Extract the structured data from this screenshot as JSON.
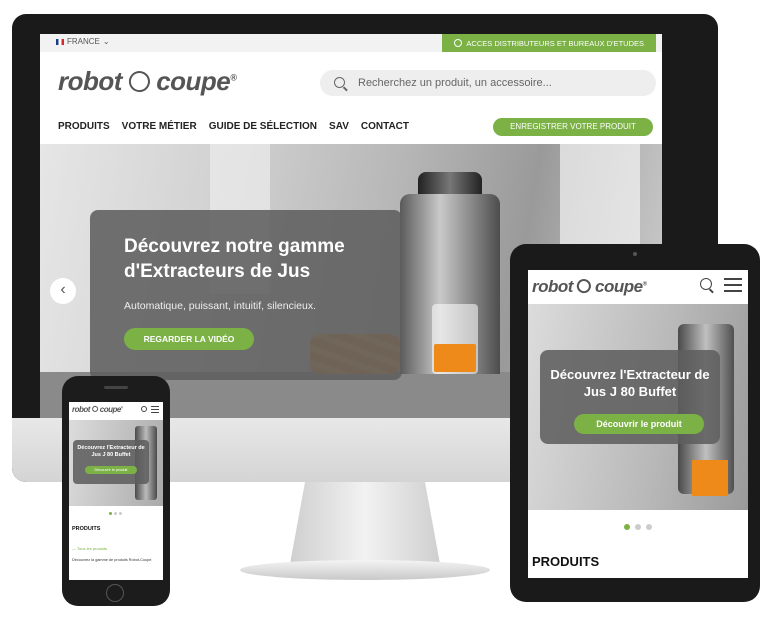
{
  "desktop": {
    "lang_label": "FRANCE",
    "distrib_label": "ACCES DISTRIBUTEURS ET BUREAUX D'ETUDES",
    "logo_left": "robot",
    "logo_right": "coupe",
    "logo_mark": "®",
    "search_placeholder": "Recherchez un produit, un accessoire...",
    "nav": [
      "PRODUITS",
      "VOTRE MÉTIER",
      "GUIDE DE SÉLECTION",
      "SAV",
      "CONTACT"
    ],
    "register_label": "ENREGISTRER VOTRE PRODUIT",
    "hero_title": "Découvrez notre gamme d'Extracteurs de Jus",
    "hero_subtitle": "Automatique, puissant, intuitif, silencieux.",
    "hero_button": "REGARDER LA VIDÉO",
    "prev_arrow": "‹"
  },
  "tablet": {
    "logo_left": "robot",
    "logo_right": "coupe",
    "logo_mark": "®",
    "hero_title": "Découvrez l'Extracteur de Jus J 80 Buffet",
    "hero_button": "Découvrir le produit",
    "section_title": "PRODUITS"
  },
  "phone": {
    "logo_left": "robot",
    "logo_right": "coupe",
    "logo_mark": "®",
    "hero_title": "Découvrez l'Extracteur de Jus J 80 Buffet",
    "hero_button": "Découvrir le produit",
    "section_title": "PRODUITS",
    "all_products": "— Tous les produits",
    "description": "Découvrez la gamme de produits Robot-Coupe."
  },
  "colors": {
    "accent": "#7bb145",
    "card": "#5f5f5f"
  }
}
